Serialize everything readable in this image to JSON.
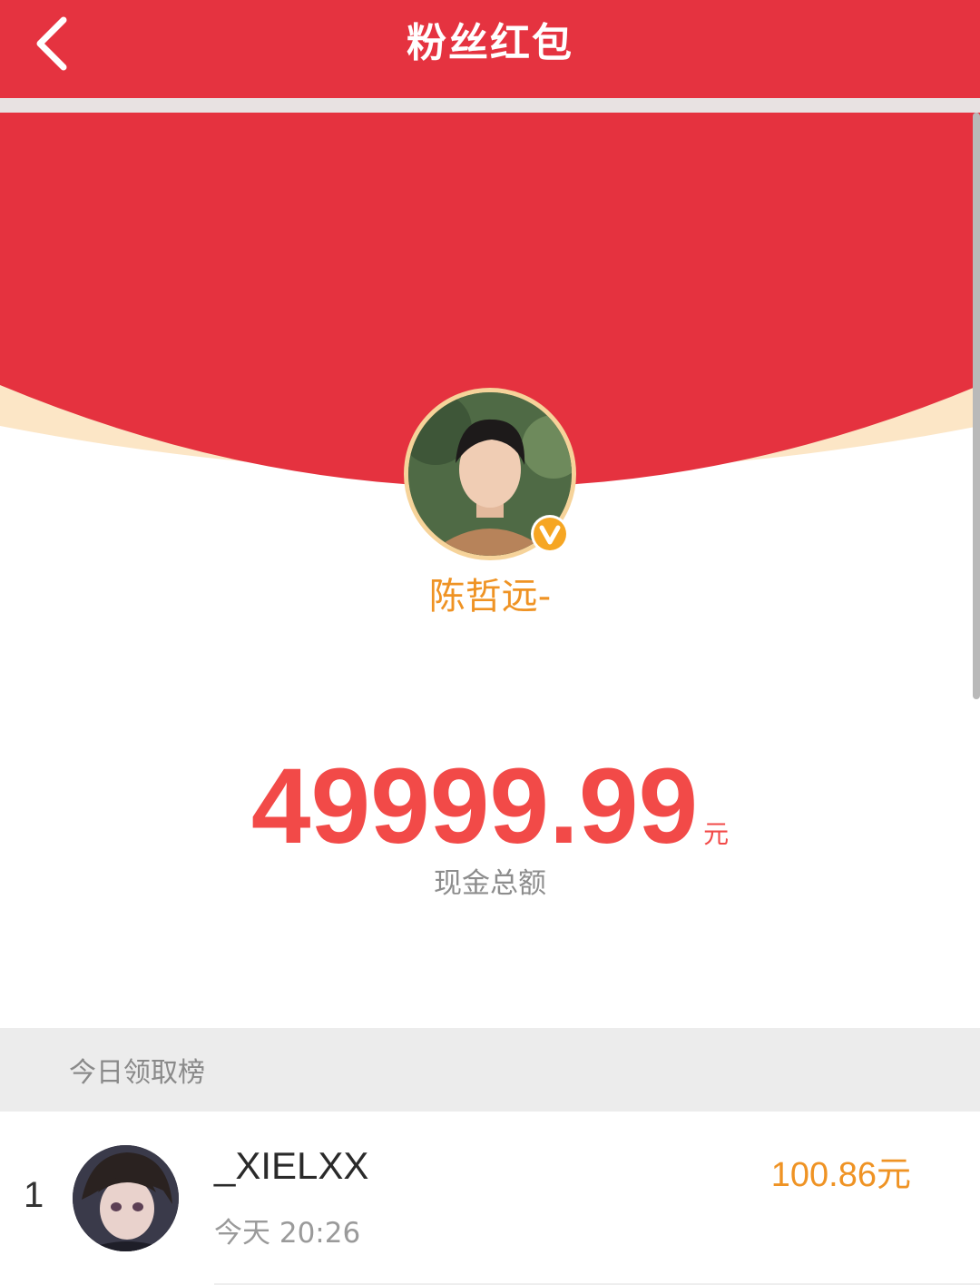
{
  "header": {
    "title": "粉丝红包",
    "back_icon": "chevron-left-icon"
  },
  "colors": {
    "brand_red": "#e53340",
    "accent_orange": "#ef9324",
    "amount_red": "#f24a48"
  },
  "sender": {
    "name": "陈哲远-",
    "verified_icon": "verified-v-badge-icon"
  },
  "redpacket": {
    "amount": "49999.99",
    "unit": "元",
    "label": "现金总额"
  },
  "leaderboard": {
    "title": "今日领取榜",
    "entries": [
      {
        "rank": "1",
        "name": "_XIELXX",
        "time": "今天 20:26",
        "amount": "100.86元"
      }
    ]
  }
}
